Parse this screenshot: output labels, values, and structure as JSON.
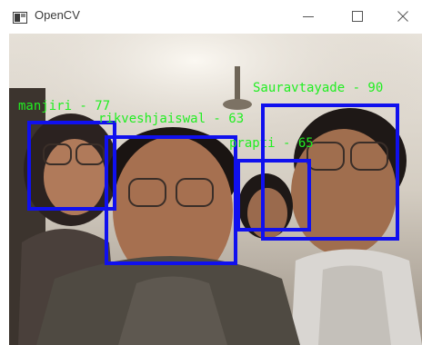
{
  "window": {
    "title": "OpenCV",
    "controls": [
      "minimize-icon",
      "maximize-icon",
      "close-icon"
    ],
    "accent": "#1010ee"
  },
  "detections": [
    {
      "label": "manjiri - 77",
      "box_color": "#1010ee",
      "text_color": "#22ee22"
    },
    {
      "label": "rikveshjaiswal - 63",
      "box_color": "#1010ee",
      "text_color": "#22ee22"
    },
    {
      "label": "prapti - 65",
      "box_color": "#1010ee",
      "text_color": "#22ee22"
    },
    {
      "label": "Sauravtayade - 90",
      "box_color": "#1010ee",
      "text_color": "#22ee22"
    }
  ]
}
